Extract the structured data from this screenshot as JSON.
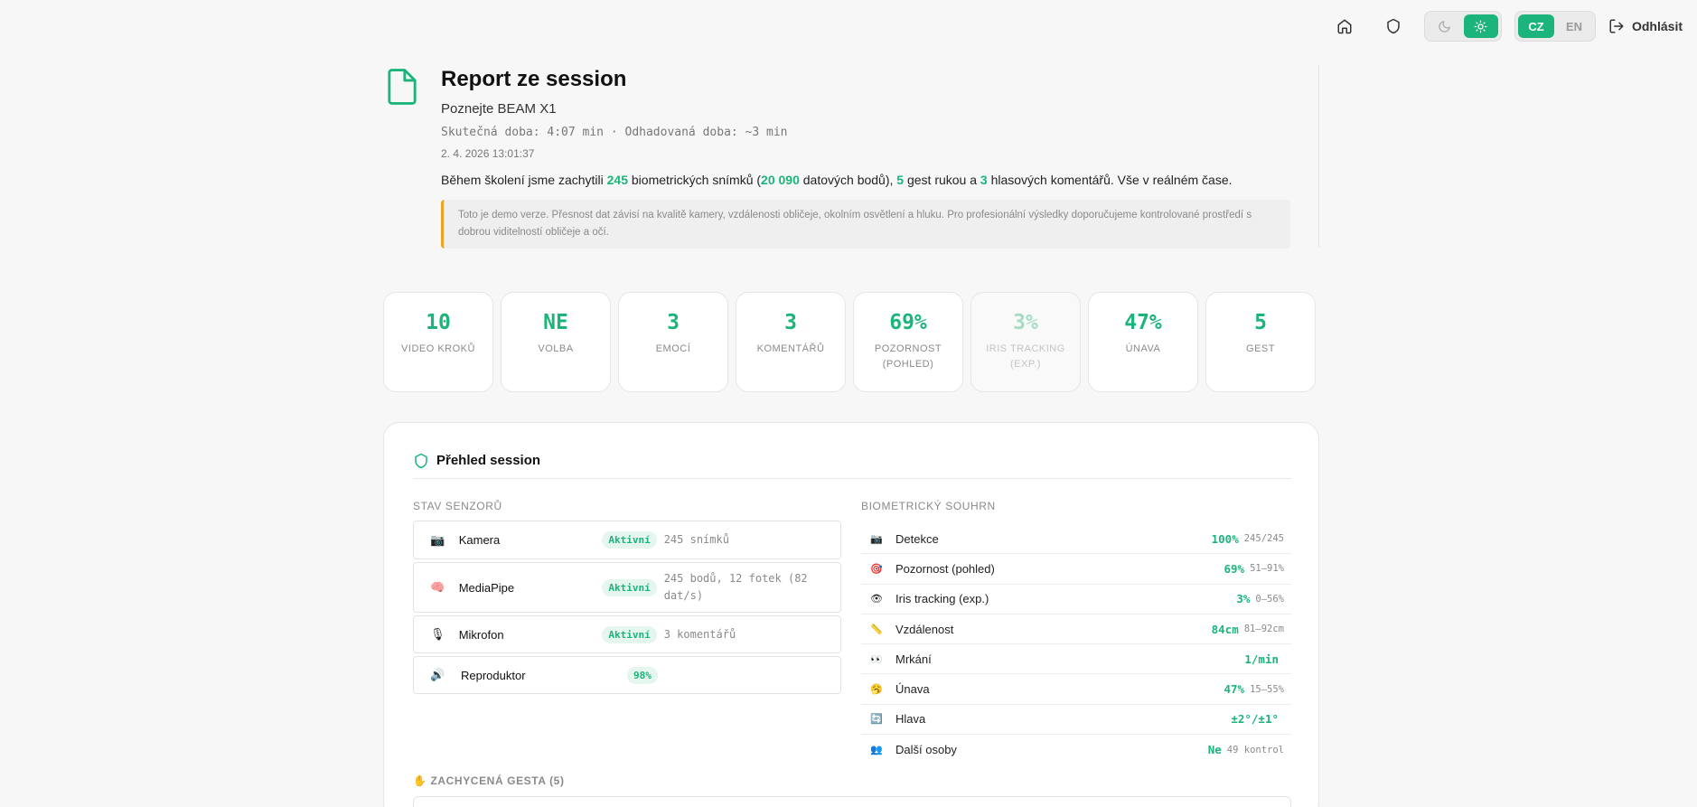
{
  "nav": {
    "lang_cz": "CZ",
    "lang_en": "EN",
    "logout_label": "Odhlásit",
    "active_theme": "light",
    "active_language": "CZ"
  },
  "header": {
    "title": "Report ze session",
    "subtitle": "Poznejte BEAM X1",
    "durations": "Skutečná doba: 4:07 min · Odhadovaná doba: ~3 min",
    "datetime": "2. 4. 2026 13:01:37",
    "summary": {
      "p1": "Během školení jsme zachytili ",
      "n1": "245",
      "p2": " biometrických snímků (",
      "n2": "20 090",
      "p3": " datových bodů), ",
      "n3": "5",
      "p4": " gest rukou a ",
      "n4": "3",
      "p5": " hlasových komentářů. Vše v reálném čase."
    },
    "notice": "Toto je demo verze. Přesnost dat závisí na kvalitě kamery, vzdálenosti obličeje, okolním osvětlení a hluku. Pro profesionální výsledky doporučujeme kontrolované prostředí s dobrou viditelností obličeje a očí."
  },
  "stats": [
    {
      "value": "10",
      "label": "VIDEO KROKŮ"
    },
    {
      "value": "NE",
      "label": "VOLBA"
    },
    {
      "value": "3",
      "label": "EMOCÍ"
    },
    {
      "value": "3",
      "label": "KOMENTÁŘŮ"
    },
    {
      "value": "69%",
      "label": "POZORNOST (POHLED)"
    },
    {
      "value": "3%",
      "label": "IRIS TRACKING (EXP.)"
    },
    {
      "value": "47%",
      "label": "ÚNAVA"
    },
    {
      "value": "5",
      "label": "GEST"
    }
  ],
  "overview": {
    "title": "Přehled session",
    "sensors_label": "STAV SENZORŮ",
    "sensors": [
      {
        "icon": "📷",
        "name": "Kamera",
        "status": "Aktivní",
        "detail": "245 snímků"
      },
      {
        "icon": "🧠",
        "name": "MediaPipe",
        "status": "Aktivní",
        "detail": "245 bodů, 12 fotek (82 dat/s)"
      },
      {
        "icon": "🎙",
        "name": "Mikrofon",
        "status": "Aktivní",
        "detail": "3 komentářů"
      },
      {
        "icon": "🔊",
        "name": "Reproduktor",
        "status": "98%",
        "detail": ""
      }
    ],
    "bio_label": "BIOMETRICKÝ SOUHRN",
    "bio": [
      {
        "icon": "📷",
        "name": "Detekce",
        "value": "100%",
        "range": "245/245"
      },
      {
        "icon": "🎯",
        "name": "Pozornost (pohled)",
        "value": "69%",
        "range": "51–91%"
      },
      {
        "icon": "👁",
        "name": "Iris tracking (exp.)",
        "value": "3%",
        "range": "0–56%"
      },
      {
        "icon": "📏",
        "name": "Vzdálenost",
        "value": "84cm",
        "range": "81–92cm"
      },
      {
        "icon": "👀",
        "name": "Mrkání",
        "value": "1/min",
        "range": ""
      },
      {
        "icon": "🥱",
        "name": "Únava",
        "value": "47%",
        "range": "15–55%"
      },
      {
        "icon": "🔄",
        "name": "Hlava",
        "value": "±2°/±1°",
        "range": ""
      },
      {
        "icon": "👥",
        "name": "Další osoby",
        "value": "Ne",
        "range": "49 kontrol"
      }
    ],
    "gestures_label": "✋ ZACHYCENÁ GESTA (5)"
  }
}
